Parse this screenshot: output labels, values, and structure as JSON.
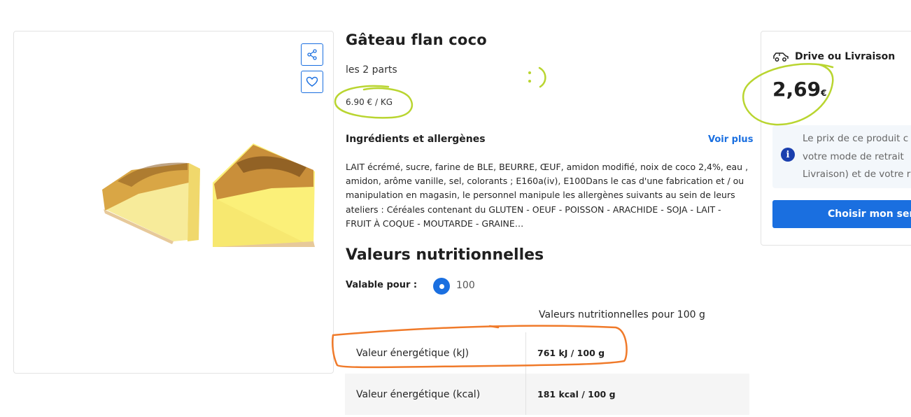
{
  "product": {
    "title": "Gâteau flan coco",
    "subtitle": "les 2 parts",
    "unit_price": "6.90 € / KG"
  },
  "image_actions": {
    "share_icon": "share-icon",
    "favorite_icon": "heart-icon"
  },
  "ingredients": {
    "heading": "Ingrédients et allergènes",
    "more_link": "Voir plus",
    "text": "LAIT écrémé, sucre, farine de BLE, BEURRE, ŒUF, amidon modifié, noix de coco 2,4%, eau , amidon, arôme vanille, sel, colorants ; E160a(iv), E100Dans le cas d'une fabrication et / ou manipulation en magasin, le personnel manipule les allergènes suivants au sein de leurs ateliers : Céréales contenant du GLUTEN - OEUF - POISSON - ARACHIDE - SOJA - LAIT - FRUIT À COQUE - MOUTARDE - GRAINE…"
  },
  "nutrition": {
    "heading": "Valeurs nutritionnelles",
    "valable_label": "Valable pour :",
    "radio_option": "100",
    "table_header": "Valeurs nutritionnelles pour 100 g",
    "rows": [
      {
        "label": "Valeur énergétique (kJ)",
        "value": "761 kJ / 100 g"
      },
      {
        "label": "Valeur énergétique (kcal)",
        "value": "181 kcal / 100 g"
      }
    ]
  },
  "purchase": {
    "mode_label": "Drive ou Livraison",
    "mode_icon": "car-icon",
    "price": "2,69",
    "currency": "€",
    "info_icon": "info-icon",
    "info_lines": [
      "Le prix de ce produit c",
      "votre mode de retrait",
      "Livraison) et de votre r"
    ],
    "cta_label": "Choisir mon serv"
  },
  "colors": {
    "accent_blue": "#1a6fe0",
    "annotation_green": "#b9d530",
    "annotation_orange": "#f07a2a"
  }
}
